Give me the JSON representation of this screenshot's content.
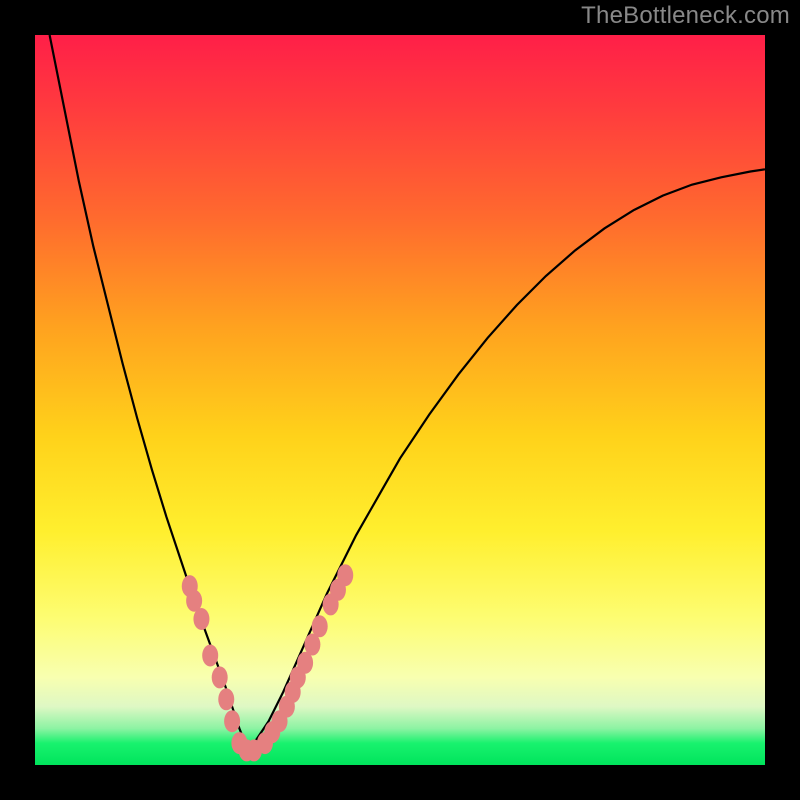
{
  "watermark": "TheBottleneck.com",
  "colors": {
    "background": "#000000",
    "curve": "#000000",
    "marker_fill": "#e58080",
    "gradient_top": "#ff1f48",
    "gradient_bottom": "#00e45c"
  },
  "chart_data": {
    "type": "line",
    "title": "",
    "xlabel": "",
    "ylabel": "",
    "xlim": [
      0,
      100
    ],
    "ylim": [
      0,
      100
    ],
    "legend": [],
    "series": [
      {
        "name": "left_curve",
        "x": [
          2,
          4,
          6,
          8,
          10,
          12,
          14,
          16,
          18,
          20,
          22,
          24,
          26,
          27,
          28,
          29
        ],
        "y": [
          100,
          90,
          80,
          71,
          63,
          55,
          47.5,
          40.5,
          34,
          28,
          22,
          16.5,
          11,
          8,
          5,
          2.5
        ]
      },
      {
        "name": "right_curve",
        "x": [
          29,
          30,
          32,
          34,
          36,
          38,
          40,
          42,
          44,
          46,
          48,
          50,
          54,
          58,
          62,
          66,
          70,
          74,
          78,
          82,
          86,
          90,
          94,
          98,
          100
        ],
        "y": [
          2.5,
          3,
          6,
          10,
          14.5,
          19,
          23.5,
          27.5,
          31.5,
          35,
          38.5,
          42,
          48,
          53.5,
          58.5,
          63,
          67,
          70.5,
          73.5,
          76,
          78,
          79.5,
          80.5,
          81.3,
          81.6
        ]
      },
      {
        "name": "markers",
        "x": [
          21.2,
          21.8,
          22.8,
          24.0,
          25.3,
          26.2,
          27.0,
          28.0,
          29.0,
          30.0,
          31.5,
          32.5,
          33.5,
          34.5,
          35.3,
          36.0,
          37.0,
          38.0,
          39.0,
          40.5,
          41.5,
          42.5
        ],
        "y": [
          24.5,
          22.5,
          20.0,
          15.0,
          12.0,
          9.0,
          6.0,
          3.0,
          2.0,
          2.0,
          3.0,
          4.5,
          6.0,
          8.0,
          10.0,
          12.0,
          14.0,
          16.5,
          19.0,
          22.0,
          24.0,
          26.0
        ]
      }
    ]
  }
}
